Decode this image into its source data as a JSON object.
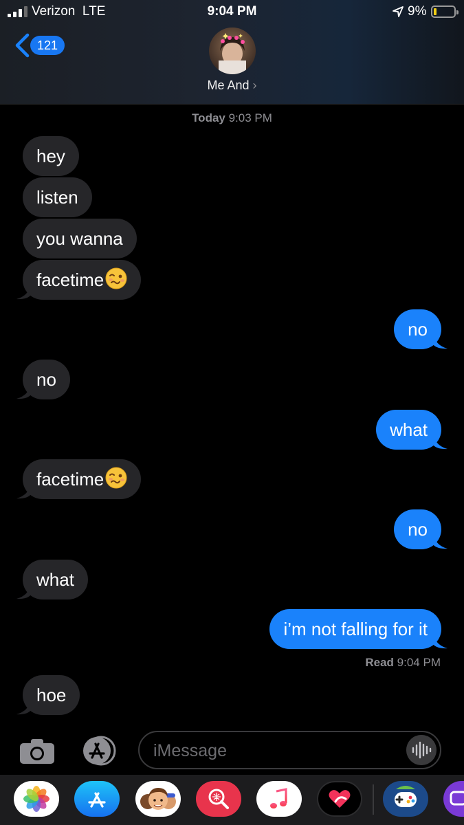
{
  "status_bar": {
    "carrier": "Verizon  LTE",
    "time": "9:04 PM",
    "battery_percent": "9%",
    "battery_level": 0.09,
    "signal_bars": 3
  },
  "nav": {
    "back_count": "121",
    "contact_name": "Me And",
    "contact_chevron": "›"
  },
  "conversation": {
    "timestamp_day": "Today",
    "timestamp_time": " 9:03 PM",
    "messages": [
      {
        "from": "them",
        "text": "hey"
      },
      {
        "from": "them",
        "text": "listen"
      },
      {
        "from": "them",
        "text": "you wanna"
      },
      {
        "from": "them",
        "text": "facetime",
        "emoji": "woozy-face"
      },
      {
        "from": "me",
        "text": "no"
      },
      {
        "from": "them",
        "text": "no"
      },
      {
        "from": "me",
        "text": "what"
      },
      {
        "from": "them",
        "text": "facetime",
        "emoji": "woozy-face"
      },
      {
        "from": "me",
        "text": "no"
      },
      {
        "from": "them",
        "text": "what"
      },
      {
        "from": "me",
        "text": "i’m not falling for it"
      },
      {
        "from": "them",
        "text": "hoe"
      }
    ],
    "read_label": "Read",
    "read_time": " 9:04 PM"
  },
  "composer": {
    "placeholder": "iMessage"
  },
  "app_drawer": {
    "apps": [
      "photos-app-icon",
      "app-store-icon",
      "memoji-icon",
      "search-images-icon",
      "music-icon",
      "digital-touch-icon",
      "game-app-icon",
      "partial-app-icon"
    ]
  },
  "colors": {
    "incoming_bubble": "#262629",
    "outgoing_bubble": "#1a82fb",
    "badge_blue": "#1877f2",
    "timestamp_gray": "#8e8e93"
  }
}
